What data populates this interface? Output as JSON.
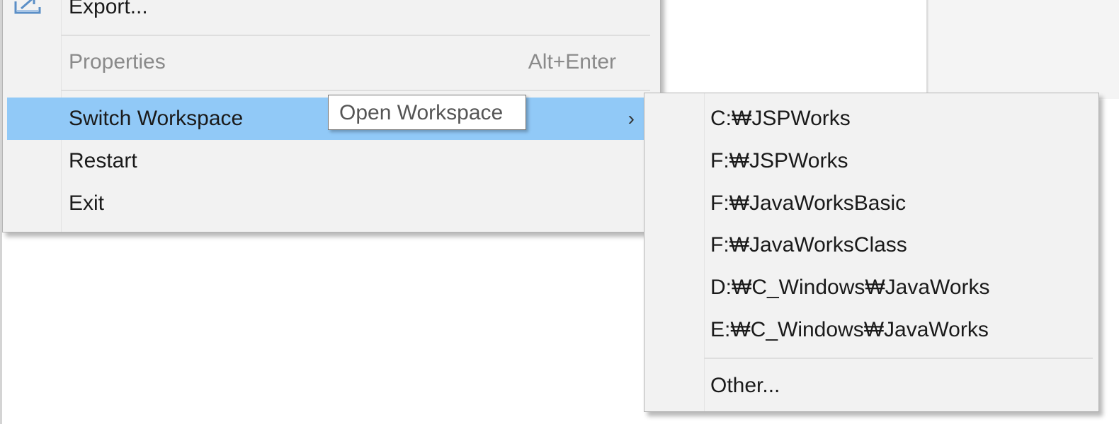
{
  "menu": {
    "items": [
      {
        "label": "Export...",
        "icon": "export-icon"
      },
      {
        "label": "Properties",
        "accelerator": "Alt+Enter",
        "disabled": true
      },
      {
        "label": "Switch Workspace",
        "submenu_arrow": "›",
        "highlighted": true
      },
      {
        "label": "Restart"
      },
      {
        "label": "Exit"
      }
    ]
  },
  "tooltip": {
    "text": "Open Workspace"
  },
  "submenu": {
    "items": [
      {
        "label": "C:₩JSPWorks"
      },
      {
        "label": "F:₩JSPWorks"
      },
      {
        "label": "F:₩JavaWorksBasic"
      },
      {
        "label": "F:₩JavaWorksClass"
      },
      {
        "label": "D:₩C_Windows₩JavaWorks"
      },
      {
        "label": "E:₩C_Windows₩JavaWorks"
      },
      {
        "label": "Other..."
      }
    ]
  },
  "colors": {
    "menu_bg": "#f2f2f2",
    "highlight": "#91c9f7",
    "disabled_text": "#8a8a8a",
    "icon_accent": "#5b8fc7"
  }
}
